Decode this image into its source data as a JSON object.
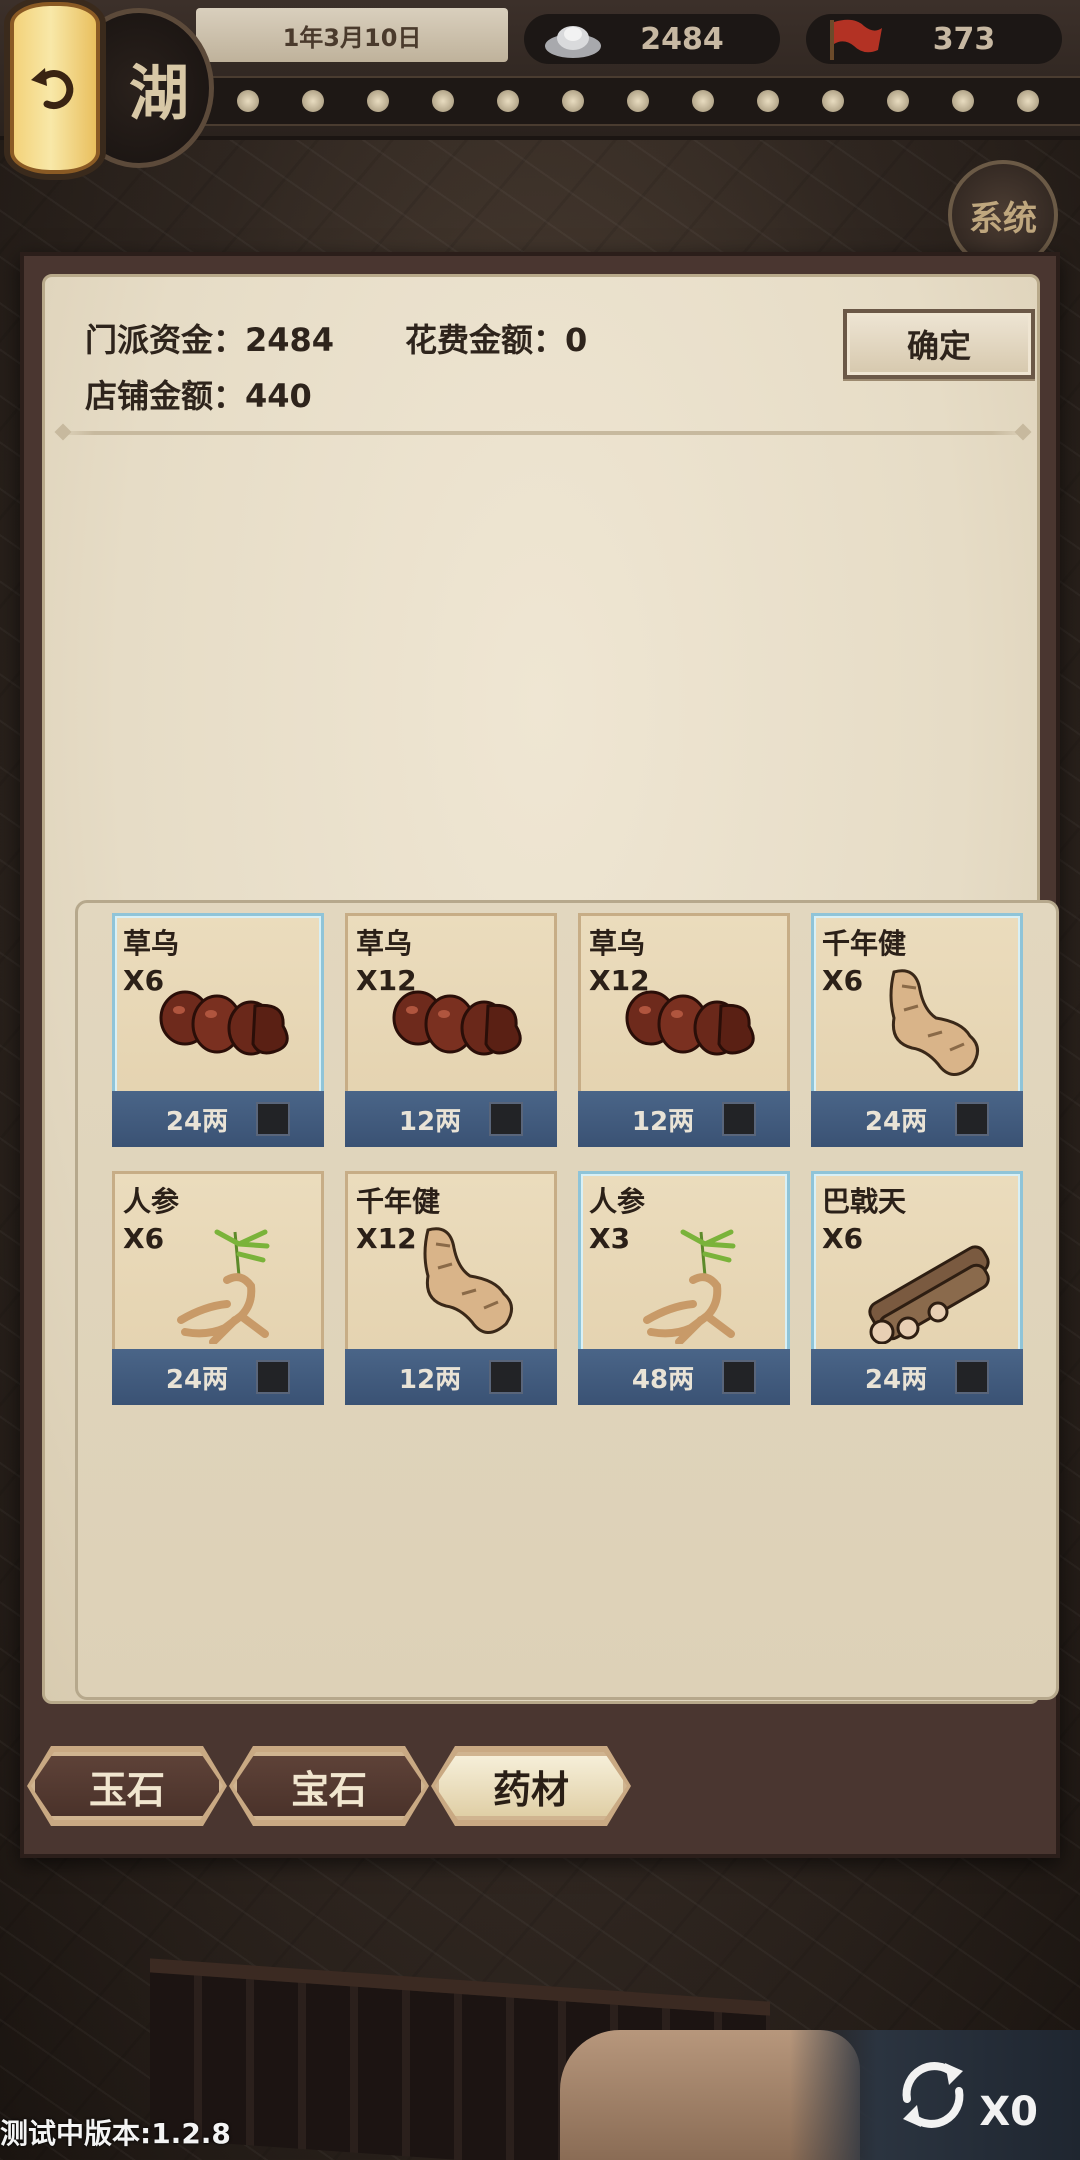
{
  "header": {
    "date": "1年3月10日",
    "silver": "2484",
    "flags": "373",
    "seal_text": "湖",
    "system_label": "系统"
  },
  "summary": {
    "sect_funds_label": "门派资金：2484",
    "spend_label": "花费金额：0",
    "shop_label": "店铺金额：440",
    "confirm_label": "确定"
  },
  "items": [
    {
      "name": "草乌",
      "qty": "X6",
      "price": "24两",
      "frame": "blue",
      "art": "caowu"
    },
    {
      "name": "草乌",
      "qty": "X12",
      "price": "12两",
      "frame": "gold",
      "art": "caowu"
    },
    {
      "name": "草乌",
      "qty": "X12",
      "price": "12两",
      "frame": "gold",
      "art": "caowu"
    },
    {
      "name": "千年健",
      "qty": "X6",
      "price": "24两",
      "frame": "blue",
      "art": "qiannianjian"
    },
    {
      "name": "人参",
      "qty": "X6",
      "price": "24两",
      "frame": "gold",
      "art": "renshen"
    },
    {
      "name": "千年健",
      "qty": "X12",
      "price": "12两",
      "frame": "gold",
      "art": "qiannianjian"
    },
    {
      "name": "人参",
      "qty": "X3",
      "price": "48两",
      "frame": "blue",
      "art": "renshen"
    },
    {
      "name": "巴戟天",
      "qty": "X6",
      "price": "24两",
      "frame": "blue",
      "art": "bajitian"
    }
  ],
  "tabs": [
    {
      "label": "玉石",
      "active": false
    },
    {
      "label": "宝石",
      "active": false
    },
    {
      "label": "药材",
      "active": true
    }
  ],
  "refresh": {
    "count": "X0"
  },
  "footer": {
    "version": "测试中版本:1.2.8"
  },
  "colors": {
    "card_footer": "#3f5779",
    "dialog_frame": "#4a3630",
    "paper": "#e6dcc6",
    "active_tab": "#f1e6c8"
  }
}
